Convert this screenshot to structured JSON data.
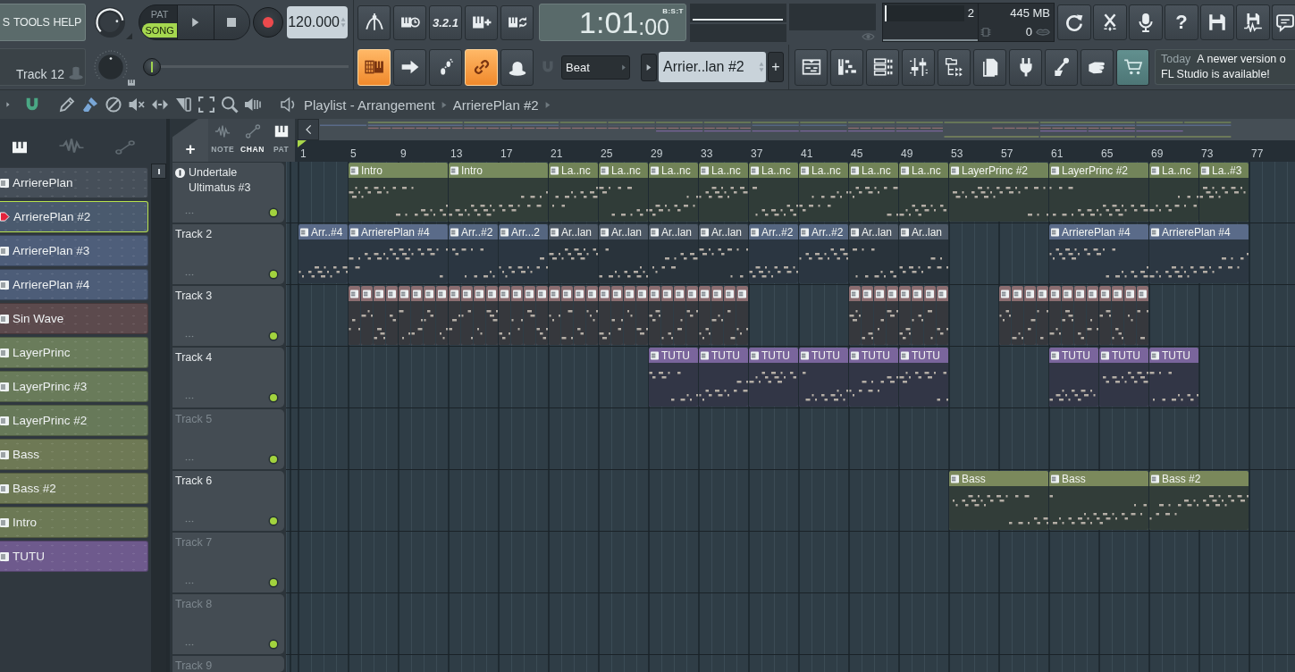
{
  "menu": [
    {
      "label": "S"
    },
    {
      "label": "TOOLS"
    },
    {
      "label": "HELP"
    }
  ],
  "hint_bar": {
    "text": "Track 12"
  },
  "master_volume": {
    "level": 0.8
  },
  "master_pitch": {
    "level": 0.5
  },
  "mode_switch": [
    {
      "label": "PAT",
      "selected": false
    },
    {
      "label": "SONG",
      "selected": true
    }
  ],
  "tempo": "120.000",
  "recording_tools": [
    {
      "kind": "metronome",
      "on": false
    },
    {
      "kind": "wait",
      "on": false
    },
    {
      "kind": "countdown",
      "label": "3.2.1",
      "on": false
    },
    {
      "kind": "stepedit",
      "on": false
    },
    {
      "kind": "loop",
      "on": false
    }
  ],
  "song_position": {
    "level": 0.0
  },
  "edit_toggles": [
    {
      "kind": "keyboard",
      "on": true
    },
    {
      "kind": "arrow",
      "on": false
    },
    {
      "kind": "steps",
      "on": false
    },
    {
      "kind": "link",
      "on": true
    },
    {
      "kind": "dome",
      "on": false
    }
  ],
  "time": {
    "value": "1:01",
    "ticks": ":00",
    "format": "B:S:T"
  },
  "monitor": {
    "level": 0.02,
    "upper_reading": "2",
    "memory": "445 MB",
    "lower_reading": "0"
  },
  "app_buttons": [
    {
      "kind": "refresh"
    },
    {
      "kind": "scissors"
    },
    {
      "kind": "mic"
    },
    {
      "kind": "help",
      "label": "?"
    },
    {
      "kind": "save"
    },
    {
      "kind": "savewave"
    },
    {
      "kind": "chat"
    }
  ],
  "snap": {
    "value": "Beat"
  },
  "pattern_selector": {
    "value": "Arrier..lan #2",
    "add_label": "+"
  },
  "windows": [
    {
      "kind": "playlist"
    },
    {
      "kind": "pianoroll"
    },
    {
      "kind": "rack"
    },
    {
      "kind": "mixer"
    },
    {
      "kind": "browser"
    },
    {
      "kind": "files"
    },
    {
      "kind": "plug"
    },
    {
      "kind": "stand"
    },
    {
      "kind": "hand"
    },
    {
      "kind": "cart"
    }
  ],
  "news": {
    "date": "Today",
    "lines": [
      "A newer version o",
      "FL Studio is available!"
    ]
  },
  "playlist_toolbar": {
    "snap_on": true,
    "tools": [
      {
        "kind": "pencil",
        "selected": false
      },
      {
        "kind": "brush",
        "selected": true
      },
      {
        "kind": "noentry",
        "selected": false
      },
      {
        "kind": "mute",
        "selected": false
      },
      {
        "kind": "slip",
        "selected": false
      },
      {
        "kind": "slice",
        "selected": false
      },
      {
        "kind": "select",
        "selected": false
      },
      {
        "kind": "zoom",
        "selected": false
      },
      {
        "kind": "playback",
        "selected": false
      }
    ],
    "breadcrumb": [
      "Playlist - Arrangement",
      "ArrierePlan #2"
    ]
  },
  "picker": {
    "tabs": [
      {
        "kind": "patterns",
        "selected": true
      },
      {
        "kind": "audio",
        "selected": false
      },
      {
        "kind": "automation",
        "selected": false
      }
    ],
    "patterns": [
      {
        "name": "ArrierePlan",
        "color": "#464f59",
        "selected": false
      },
      {
        "name": "ArrierePlan #2",
        "color": "#4a5a6e",
        "selected": true
      },
      {
        "name": "ArrierePlan #3",
        "color": "#4e5e7a",
        "selected": false
      },
      {
        "name": "ArrierePlan #4",
        "color": "#4d5d78",
        "selected": false
      },
      {
        "name": "Sin Wave",
        "color": "#5c4a4d",
        "selected": false
      },
      {
        "name": "LayerPrinc",
        "color": "#6a7c5b",
        "selected": false
      },
      {
        "name": "LayerPrinc #3",
        "color": "#697b5a",
        "selected": false
      },
      {
        "name": "LayerPrinc #2",
        "color": "#677959",
        "selected": false
      },
      {
        "name": "Bass",
        "color": "#6e7955",
        "selected": false
      },
      {
        "name": "Bass #2",
        "color": "#6e7955",
        "selected": false
      },
      {
        "name": "Intro",
        "color": "#6c7955",
        "selected": false
      },
      {
        "name": "TUTU",
        "color": "#6e5a8d",
        "selected": false
      }
    ]
  },
  "track_header": {
    "add_label": "+",
    "filters": [
      {
        "label": "NOTE",
        "kind": "audio",
        "selected": false
      },
      {
        "label": "CHAN",
        "kind": "automation",
        "selected": true
      },
      {
        "label": "PAT",
        "kind": "patterns",
        "selected": false
      }
    ]
  },
  "ruler": [
    "1",
    "5",
    "9",
    "13",
    "17",
    "21",
    "25",
    "29",
    "33",
    "37",
    "41",
    "45",
    "49",
    "53",
    "57",
    "61",
    "65",
    "69",
    "73",
    "77"
  ],
  "tracks": [
    {
      "name": "Undertale Ultimatus #3",
      "has_icon": true,
      "enabled": true,
      "clips": [
        {
          "label": "Intro",
          "color": "#778a5d"
        },
        {
          "label": "Intro",
          "color": "#778a5d"
        },
        {
          "label": "La..nc",
          "color": "#718357"
        },
        {
          "label": "La..nc",
          "color": "#718357"
        },
        {
          "label": "La..nc",
          "color": "#718357"
        },
        {
          "label": "La..nc",
          "color": "#718357"
        },
        {
          "label": "La..nc",
          "color": "#718357"
        },
        {
          "label": "La..nc",
          "color": "#718357"
        },
        {
          "label": "La..nc",
          "color": "#718357"
        },
        {
          "label": "La..nc",
          "color": "#718357"
        },
        {
          "label": "LayerPrinc #2",
          "color": "#72845a"
        },
        {
          "label": "LayerPrinc #2",
          "color": "#72845a"
        },
        {
          "label": "La..nc",
          "color": "#718357"
        },
        {
          "label": "La..#3",
          "color": "#718357"
        }
      ]
    },
    {
      "name": "Track 2",
      "has_icon": false,
      "enabled": true,
      "clips": [
        {
          "label": "Arr..#4",
          "color": "#5a6b89"
        },
        {
          "label": "ArrierePlan #4",
          "color": "#5a6b89"
        },
        {
          "label": "Arr..#2",
          "color": "#556680"
        },
        {
          "label": "Arr...2",
          "color": "#556680"
        },
        {
          "label": "Ar..lan",
          "color": "#4c5764"
        },
        {
          "label": "Ar..lan",
          "color": "#4c5764"
        },
        {
          "label": "Ar..lan",
          "color": "#4c5764"
        },
        {
          "label": "Ar..lan",
          "color": "#4c5764"
        },
        {
          "label": "Arr..#2",
          "color": "#556680"
        },
        {
          "label": "Arr..#2",
          "color": "#556680"
        },
        {
          "label": "Ar..lan",
          "color": "#4c5764"
        },
        {
          "label": "Ar..lan",
          "color": "#4c5764"
        },
        {
          "label": "ArrierePlan #4",
          "color": "#5a6b89"
        },
        {
          "label": "ArrierePlan #4",
          "color": "#5a6b89"
        }
      ]
    },
    {
      "name": "Track 3",
      "has_icon": false,
      "enabled": true,
      "clips": [
        {
          "color": "#8b6d70"
        },
        {
          "color": "#8b6d70"
        },
        {
          "color": "#8b6d70"
        },
        {
          "color": "#8b6d70"
        },
        {
          "color": "#8b6d70"
        },
        {
          "color": "#8b6d70"
        },
        {
          "color": "#8b6d70"
        },
        {
          "color": "#8b6d70"
        },
        {
          "color": "#8b6d70"
        },
        {
          "color": "#8b6d70"
        },
        {
          "color": "#8b6d70"
        },
        {
          "color": "#8b6d70"
        },
        {
          "color": "#8b6d70"
        },
        {
          "color": "#8b6d70"
        },
        {
          "color": "#8b6d70"
        },
        {
          "color": "#8b6d70"
        },
        {
          "color": "#8b6d70"
        },
        {
          "color": "#8b6d70"
        },
        {
          "color": "#8b6d70"
        },
        {
          "color": "#8b6d70"
        },
        {
          "color": "#8b6d70"
        },
        {
          "color": "#8b6d70"
        },
        {
          "color": "#8b6d70"
        },
        {
          "color": "#8b6d70"
        },
        {
          "color": "#8b6d70"
        },
        {
          "color": "#8b6d70"
        },
        {
          "color": "#8b6d70"
        },
        {
          "color": "#8b6d70"
        },
        {
          "color": "#8b6d70"
        },
        {
          "color": "#8b6d70"
        },
        {
          "color": "#8b6d70"
        },
        {
          "color": "#8b6d70"
        },
        {
          "color": "#8b6d70"
        },
        {
          "color": "#8b6d70"
        },
        {
          "color": "#8b6d70"
        },
        {
          "color": "#8b6d70"
        },
        {
          "color": "#8b6d70"
        },
        {
          "color": "#8b6d70"
        },
        {
          "color": "#8b6d70"
        },
        {
          "color": "#8b6d70"
        },
        {
          "color": "#8b6d70"
        },
        {
          "color": "#8b6d70"
        },
        {
          "color": "#8b6d70"
        },
        {
          "color": "#8b6d70"
        },
        {
          "color": "#8b6d70"
        },
        {
          "color": "#8b6d70"
        },
        {
          "color": "#8b6d70"
        },
        {
          "color": "#8b6d70"
        },
        {
          "color": "#8b6d70"
        },
        {
          "color": "#8b6d70"
        },
        {
          "color": "#8b6d70"
        },
        {
          "color": "#8b6d70"
        }
      ]
    },
    {
      "name": "Track 4",
      "has_icon": false,
      "enabled": true,
      "clips": [
        {
          "label": "TUTU",
          "color": "#7a659c"
        },
        {
          "label": "TUTU",
          "color": "#7a659c"
        },
        {
          "label": "TUTU",
          "color": "#7a659c"
        },
        {
          "label": "TUTU",
          "color": "#7a659c"
        },
        {
          "label": "TUTU",
          "color": "#7a659c"
        },
        {
          "label": "TUTU",
          "color": "#7a659c"
        },
        {
          "label": "TUTU",
          "color": "#7a659c"
        },
        {
          "label": "TUTU",
          "color": "#7a659c"
        },
        {
          "label": "TUTU",
          "color": "#7a659c"
        }
      ]
    },
    {
      "name": "Track 5",
      "has_icon": false,
      "enabled": true
    },
    {
      "name": "Track 6",
      "has_icon": false,
      "enabled": true,
      "clips": [
        {
          "label": "Bass",
          "color": "#7b895c"
        },
        {
          "label": "Bass",
          "color": "#7b895c"
        },
        {
          "label": "Bass #2",
          "color": "#7a885b"
        }
      ]
    },
    {
      "name": "Track 7",
      "has_icon": false,
      "enabled": true
    },
    {
      "name": "Track 8",
      "has_icon": false,
      "enabled": true
    },
    {
      "name": "Track 9",
      "has_icon": false
    }
  ]
}
